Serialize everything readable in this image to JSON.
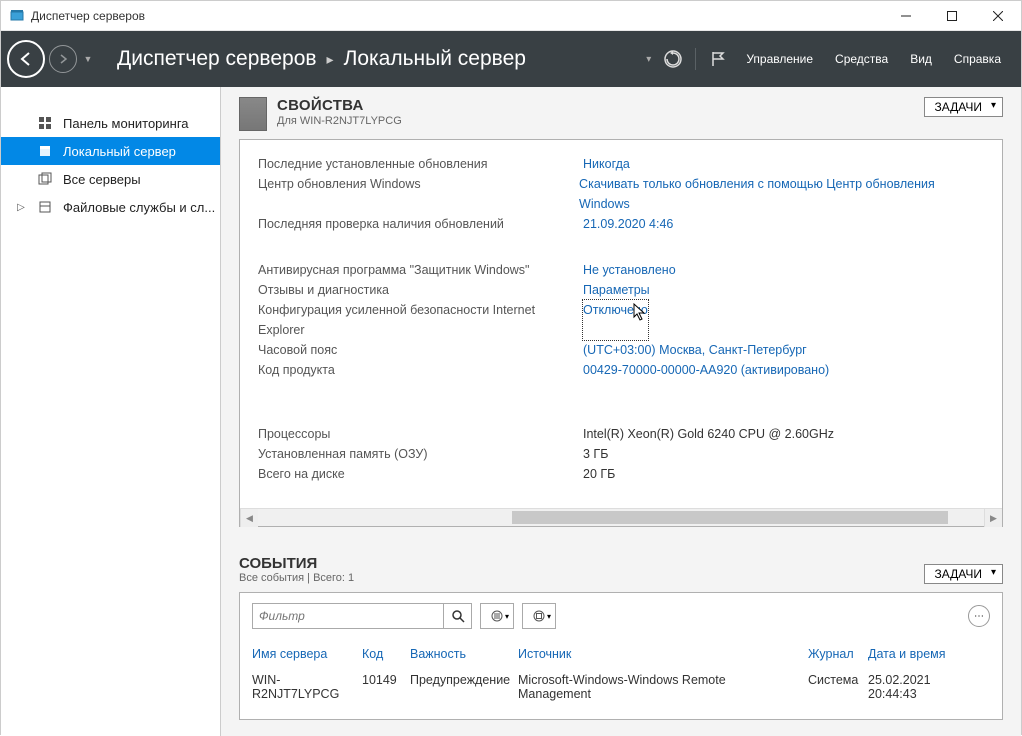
{
  "window": {
    "title": "Диспетчер серверов"
  },
  "header": {
    "app": "Диспетчер серверов",
    "page": "Локальный сервер",
    "menus": {
      "manage": "Управление",
      "tools": "Средства",
      "view": "Вид",
      "help": "Справка"
    }
  },
  "sidebar": {
    "items": [
      {
        "label": "Панель мониторинга",
        "icon": "dashboard"
      },
      {
        "label": "Локальный сервер",
        "icon": "server",
        "selected": true
      },
      {
        "label": "Все серверы",
        "icon": "servers"
      },
      {
        "label": "Файловые службы и сл...",
        "icon": "files",
        "expandable": true
      }
    ]
  },
  "properties": {
    "title": "СВОЙСТВА",
    "subtitle": "Для WIN-R2NJT7LYPCG",
    "tasks_label": "ЗАДАЧИ",
    "rows": [
      {
        "label": "Последние установленные обновления",
        "value": "Никогда"
      },
      {
        "label": "Центр обновления Windows",
        "value": "Скачивать только обновления с помощью Центр обновления Windows"
      },
      {
        "label": "Последняя проверка наличия обновлений",
        "value": "21.09.2020 4:46"
      }
    ],
    "rows2": [
      {
        "label": "Антивирусная программа \"Защитник Windows\"",
        "value": "Не установлено"
      },
      {
        "label": "Отзывы и диагностика",
        "value": "Параметры"
      },
      {
        "label": "Конфигурация усиленной безопасности Internet Explorer",
        "value": "Отключено",
        "focus": true
      },
      {
        "label": "Часовой пояс",
        "value": "(UTC+03:00) Москва, Санкт-Петербург"
      },
      {
        "label": "Код продукта",
        "value": "00429-70000-00000-AA920 (активировано)"
      }
    ],
    "rows3": [
      {
        "label": "Процессоры",
        "value": "Intel(R) Xeon(R) Gold 6240 CPU @ 2.60GHz"
      },
      {
        "label": "Установленная память (ОЗУ)",
        "value": "3 ГБ"
      },
      {
        "label": "Всего на диске",
        "value": "20 ГБ"
      }
    ]
  },
  "events": {
    "title": "СОБЫТИЯ",
    "subtitle": "Все события | Всего: 1",
    "tasks_label": "ЗАДАЧИ",
    "filter_placeholder": "Фильтр",
    "columns": {
      "server": "Имя сервера",
      "code": "Код",
      "severity": "Важность",
      "source": "Источник",
      "log": "Журнал",
      "datetime": "Дата и время"
    },
    "rows": [
      {
        "server": "WIN-R2NJT7LYPCG",
        "code": "10149",
        "severity": "Предупреждение",
        "source": "Microsoft-Windows-Windows Remote Management",
        "log": "Система",
        "datetime": "25.02.2021 20:44:43"
      }
    ]
  }
}
